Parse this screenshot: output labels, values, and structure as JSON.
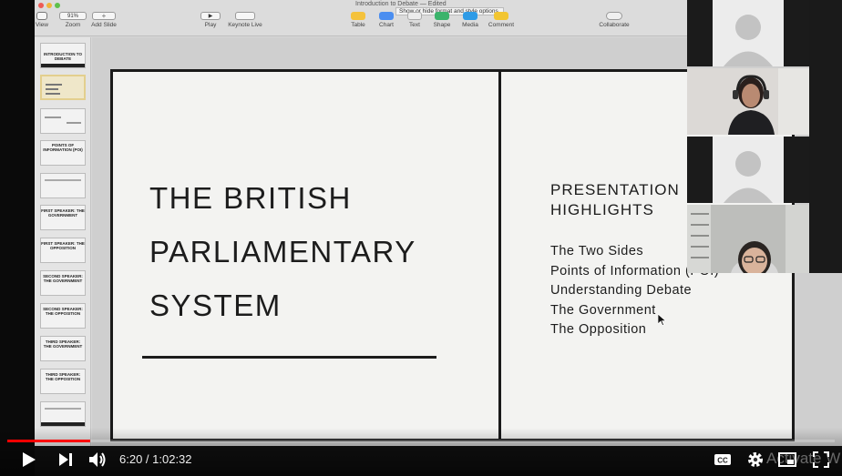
{
  "keynote": {
    "window_title": "Introduction to Debate — Edited",
    "tooltip": "Show or hide format and style options.",
    "toolbar": {
      "view": "View",
      "zoom_value": "91%",
      "zoom": "Zoom",
      "add_slide": "Add Slide",
      "play": "Play",
      "keynote_live": "Keynote Live",
      "table": "Table",
      "chart": "Chart",
      "text": "Text",
      "shape": "Shape",
      "media": "Media",
      "comment": "Comment",
      "collaborate": "Collaborate"
    },
    "navigator": {
      "thumbs": [
        "INTRODUCTION TO DEBATE",
        "",
        "",
        "POINTS OF INFORMATION (POI)",
        "",
        "FIRST SPEAKER: THE GOVERNMENT",
        "FIRST SPEAKER: THE OPPOSITION",
        "SECOND SPEAKER: THE GOVERNMENT",
        "SECOND SPEAKER: THE OPPOSITION",
        "THIRD SPEAKER: THE GOVERNMENT",
        "THIRD SPEAKER: THE OPPOSITION",
        ""
      ]
    },
    "slide": {
      "title": "THE BRITISH\nPARLIAMENTARY\nSYSTEM",
      "highlights_heading": "PRESENTATION HIGHLIGHTS",
      "highlights": [
        "The Two Sides",
        "Points of Information (POI)",
        "Understanding Debate",
        "The Government",
        "The Opposition"
      ]
    }
  },
  "player": {
    "progress_fraction": 0.1,
    "current_time": "6:20",
    "duration": "1:02:32",
    "time_display": "6:20 / 1:02:32",
    "watermark": "Activate W"
  },
  "colors": {
    "progress": "#ff0000",
    "slide_bg": "#f3f3f1",
    "slide_ink": "#1c1c1c"
  },
  "icons": [
    "play-icon",
    "next-icon",
    "volume-icon",
    "captions-icon",
    "settings-icon",
    "miniplayer-icon",
    "fullscreen-icon"
  ]
}
